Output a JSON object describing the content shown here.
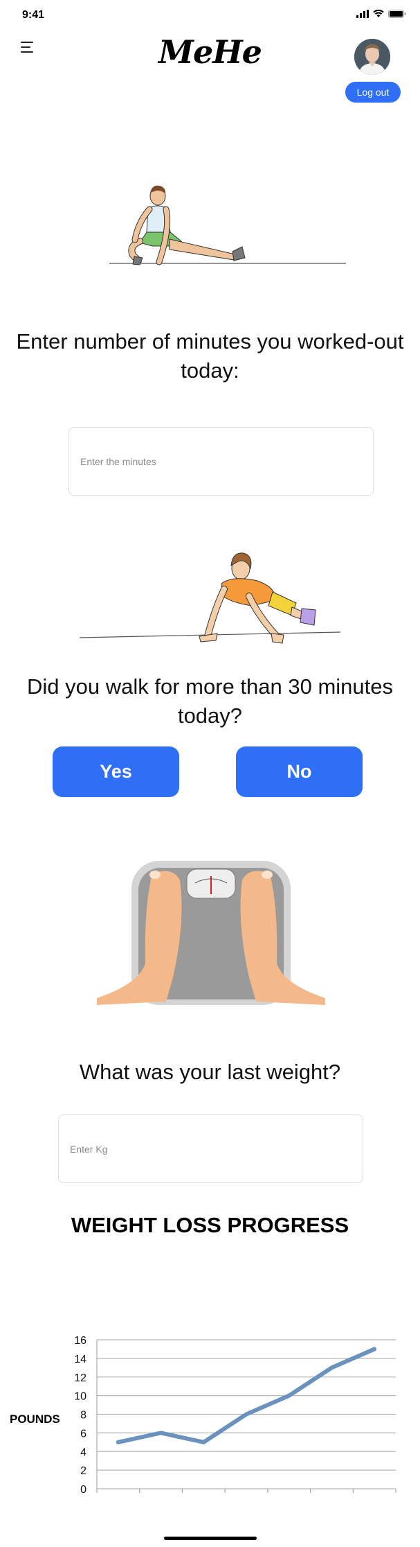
{
  "status_bar": {
    "time": "9:41"
  },
  "header": {
    "brand": "MeHe",
    "logout_label": "Log out"
  },
  "workout": {
    "question": "Enter number of minutes you worked-out today:",
    "placeholder": "Enter the minutes"
  },
  "walk": {
    "question": "Did you walk for more than 30 minutes today?",
    "yes_label": "Yes",
    "no_label": "No"
  },
  "weight": {
    "question": "What was your last weight?",
    "placeholder": "Enter Kg"
  },
  "chart_section": {
    "title": "WEIGHT LOSS PROGRESS"
  },
  "colors": {
    "accent": "#2f6ff5",
    "line": "#6a92bd"
  },
  "chart_data": {
    "type": "line",
    "title": "WEIGHT LOSS PROGRESS",
    "ylabel": "POUNDS",
    "xlabel": "",
    "ylim": [
      0,
      16
    ],
    "yticks": [
      0,
      2,
      4,
      6,
      8,
      10,
      12,
      14,
      16
    ],
    "grid": true,
    "series": [
      {
        "values": [
          5,
          6,
          5,
          8,
          10,
          13,
          15
        ]
      }
    ]
  }
}
